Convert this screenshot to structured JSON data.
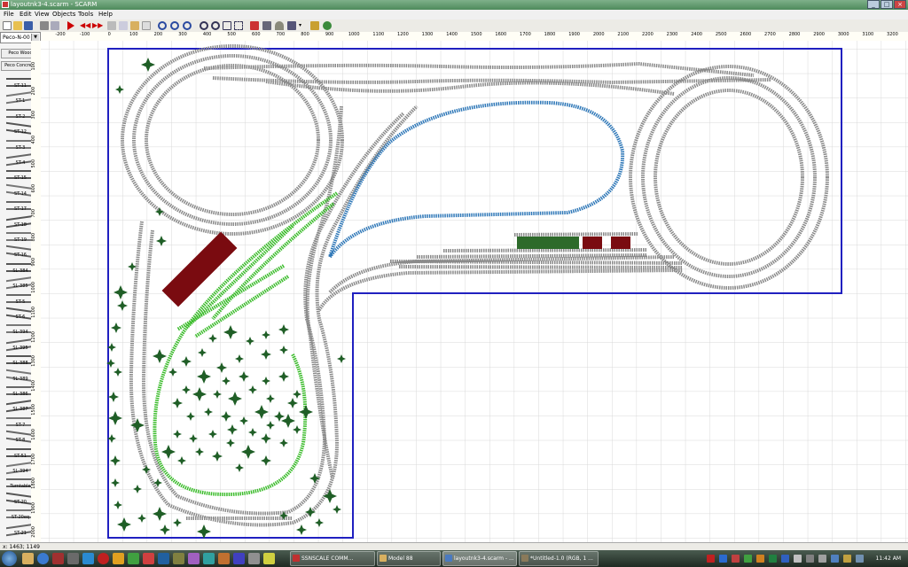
{
  "window": {
    "title": "layoutnk3-4.scarm - SCARM",
    "minimize": "_",
    "maximize": "□",
    "close": "×"
  },
  "menu": [
    "File",
    "Edit",
    "View",
    "Objects",
    "Tools",
    "Help"
  ],
  "toolbar_icons": [
    "new-icon",
    "open-icon",
    "save-icon",
    "print-icon",
    "print-preview-icon",
    "play-icon",
    "rewind-icon",
    "forward-icon",
    "cut-icon",
    "copy-icon",
    "paste-icon",
    "delete-icon",
    "undo-icon",
    "redo-icon",
    "redo-all-icon",
    "zoom-in-icon",
    "zoom-out-icon",
    "zoom-fit-icon",
    "zoom-window-icon",
    "track-icon",
    "flex-track-icon",
    "tunnel-icon",
    "3d-view-icon",
    "dropdown-icon",
    "train-icon",
    "settings-icon"
  ],
  "palette": {
    "library": "Peco-N-00",
    "buttons": [
      "Peco Wood",
      "Peco Concrete"
    ],
    "items": [
      "ST-11",
      "ST-1",
      "ST-2",
      "ST-12",
      "ST-3",
      "ST-4",
      "ST-15",
      "ST-14",
      "ST-17",
      "ST-18",
      "ST-19",
      "ST-16",
      "SL-384",
      "SL-385",
      "ST-5",
      "ST-6",
      "SL-394",
      "SL-395",
      "SL-388",
      "SL-389",
      "SL-386",
      "SL-387",
      "ST-7",
      "ST-8",
      "ST-51",
      "SL-394",
      "Turntable",
      "ST-20",
      "ST-20eq",
      "ST-21"
    ]
  },
  "ruler_top": [
    "-200",
    "-100",
    "0",
    "100",
    "200",
    "300",
    "400",
    "500",
    "600",
    "700",
    "800",
    "900",
    "1000",
    "1100",
    "1200",
    "1300",
    "1400",
    "1500",
    "1600",
    "1700",
    "1800",
    "1900",
    "2000",
    "2100",
    "2200",
    "2300",
    "2400",
    "2500",
    "2600",
    "2700",
    "2800",
    "2900",
    "3000",
    "3100",
    "3200"
  ],
  "ruler_left": [
    "100",
    "200",
    "300",
    "400",
    "500",
    "600",
    "700",
    "800",
    "900",
    "1000",
    "1100",
    "1200",
    "1300",
    "1400",
    "1500",
    "1600",
    "1700",
    "1800",
    "1900",
    "2000"
  ],
  "status": "x: 1463; 1149",
  "colors": {
    "board": "#2020c0",
    "track": "#8a8a8a",
    "blue_track": "#2f78b8",
    "green_track": "#3cbc2c",
    "building": "#7a0b10",
    "tree": "#1f5e26",
    "shed_green": "#2d6a2a"
  },
  "taskbar": {
    "tasks": [
      "SSNSCALE COMM...",
      "Model 88",
      "layoutnk3-4.scarm - ...",
      "*Untitled-1.0 (RGB, 1 ..."
    ],
    "clock": "11:42 AM"
  }
}
